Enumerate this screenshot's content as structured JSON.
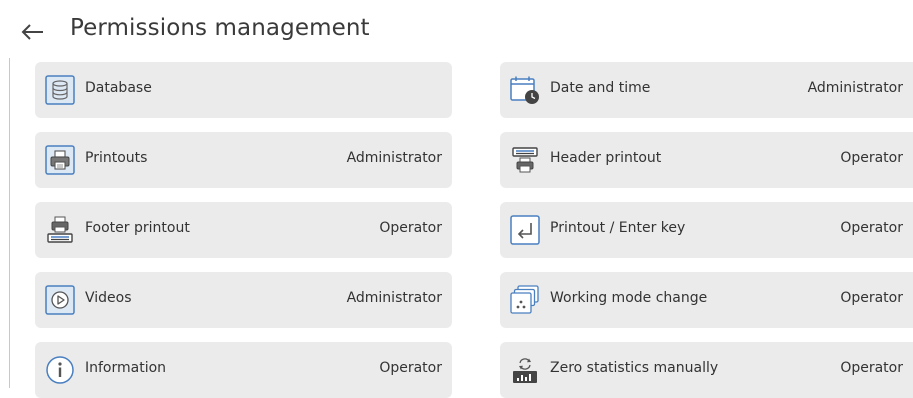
{
  "header": {
    "title": "Permissions management"
  },
  "colors": {
    "icon_blue": "#4a7fc0",
    "icon_dark": "#444444",
    "tile_bg": "#ebebeb"
  },
  "items": [
    {
      "label": "Database",
      "value": "",
      "icon": "database-icon"
    },
    {
      "label": "Date and time",
      "value": "Administrator",
      "icon": "calendar-clock-icon"
    },
    {
      "label": "Printouts",
      "value": "Administrator",
      "icon": "printer-icon"
    },
    {
      "label": "Header printout",
      "value": "Operator",
      "icon": "header-printout-icon"
    },
    {
      "label": "Footer printout",
      "value": "Operator",
      "icon": "footer-printout-icon"
    },
    {
      "label": "Printout / Enter key",
      "value": "Operator",
      "icon": "enter-key-icon"
    },
    {
      "label": "Videos",
      "value": "Administrator",
      "icon": "play-video-icon"
    },
    {
      "label": "Working mode change",
      "value": "Operator",
      "icon": "working-mode-icon"
    },
    {
      "label": "Information",
      "value": "Operator",
      "icon": "info-icon"
    },
    {
      "label": "Zero statistics manually",
      "value": "Operator",
      "icon": "zero-statistics-icon"
    }
  ]
}
